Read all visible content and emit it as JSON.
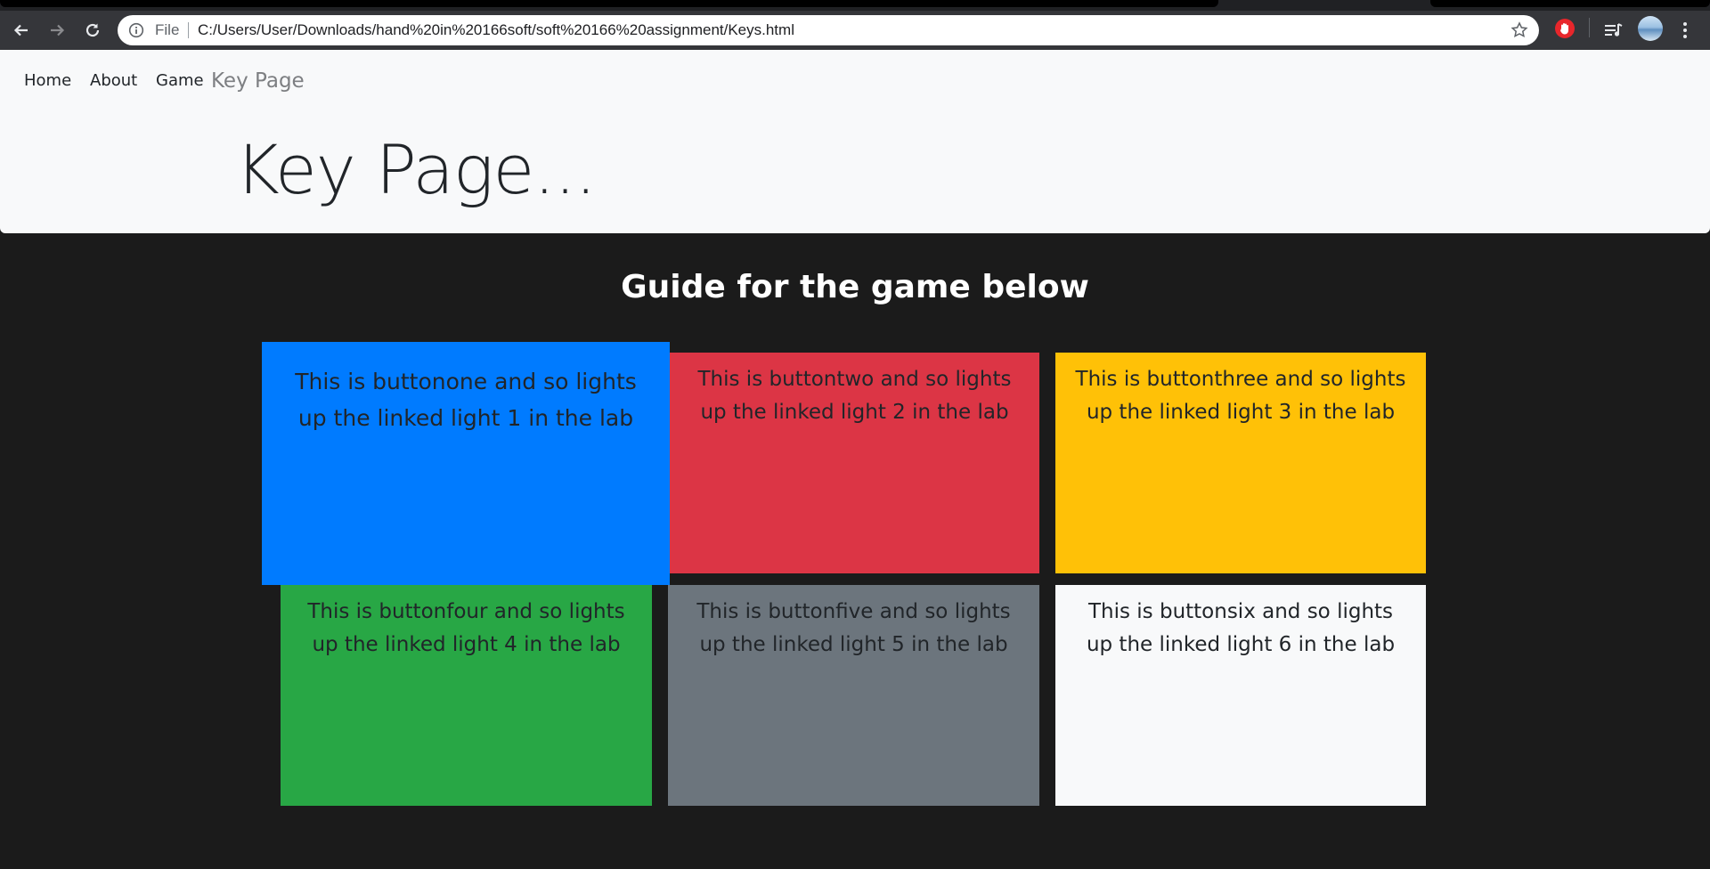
{
  "browser": {
    "address_scheme": "File",
    "url": "C:/Users/User/Downloads/hand%20in%20166soft/soft%20166%20assignment/Keys.html",
    "icons": {
      "back": "back-arrow-icon",
      "forward": "forward-arrow-icon",
      "reload": "reload-icon",
      "info": "info-icon",
      "bookmark": "star-icon",
      "extension": "hand-stop-icon",
      "media": "media-queue-icon",
      "profile": "avatar",
      "menu": "kebab-menu-icon"
    }
  },
  "navbar": {
    "links": [
      "Home",
      "About",
      "Game"
    ],
    "brand": "Key Page"
  },
  "jumbotron": {
    "title": "Key Page..."
  },
  "main": {
    "heading": "Guide for the game below",
    "cards": [
      {
        "text": "This is buttonone and so lights up the linked light 1 in the lab",
        "color": "#007bff"
      },
      {
        "text": "This is buttontwo and so lights up the linked light 2 in the lab",
        "color": "#dc3545"
      },
      {
        "text": "This is buttonthree and so lights up the linked light 3 in the lab",
        "color": "#ffc107"
      },
      {
        "text": "This is buttonfour and so lights up the linked light 4 in the lab",
        "color": "#28a745"
      },
      {
        "text": "This is buttonfive and so lights up the linked light 5 in the lab",
        "color": "#6c757d"
      },
      {
        "text": "This is buttonsix and so lights up the linked light 6 in the lab",
        "color": "#f8f9fa"
      }
    ]
  },
  "colors": {
    "page_background": "#1b1b1b",
    "header_background": "#f8f9fa",
    "chrome_toolbar": "#35363a"
  }
}
